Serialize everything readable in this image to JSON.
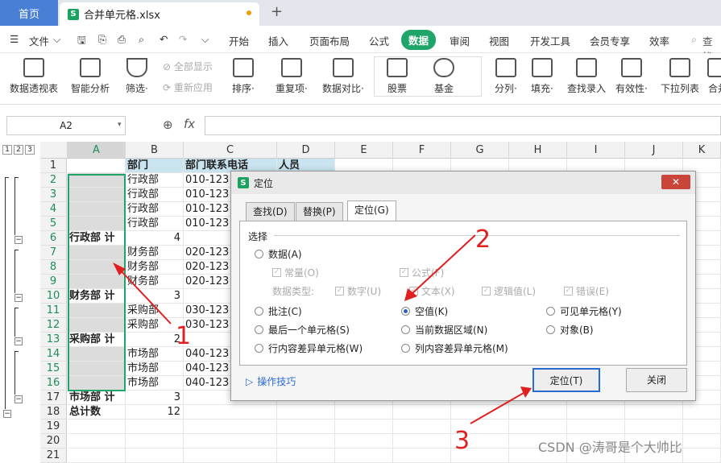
{
  "tabs": {
    "home": "首页",
    "file": "合并单元格.xlsx",
    "plus": "+"
  },
  "menu": {
    "file": "文件",
    "items": [
      "开始",
      "插入",
      "页面布局",
      "公式",
      "数据",
      "审阅",
      "视图",
      "开发工具",
      "会员专享",
      "效率"
    ],
    "active": "数据",
    "search": "查找"
  },
  "toolbar": {
    "items": [
      "数据透视表",
      "智能分析",
      "筛选·",
      "排序·",
      "重复项·",
      "数据对比·",
      "股票",
      "基金",
      "分列·",
      "填充·",
      "查找录入",
      "有效性·",
      "下拉列表",
      "合并"
    ],
    "show_all": "全部显示",
    "reapply": "重新应用"
  },
  "formula": {
    "name_box": "A2",
    "fx": "fx",
    "zoom_icon": "zoom-icon"
  },
  "outline_levels": [
    "1",
    "2",
    "3"
  ],
  "columns": [
    "A",
    "B",
    "C",
    "D",
    "E",
    "F",
    "G",
    "H",
    "I",
    "J",
    "K"
  ],
  "rows": [
    "1",
    "2",
    "3",
    "4",
    "5",
    "6",
    "7",
    "8",
    "9",
    "10",
    "11",
    "12",
    "13",
    "14",
    "15",
    "16",
    "17",
    "18",
    "19",
    "20",
    "21"
  ],
  "cells": {
    "B1": "部门",
    "C1": "部门联系电话",
    "D1": "人员",
    "B2": "行政部",
    "C2": "010-123",
    "B3": "行政部",
    "C3": "010-123",
    "B4": "行政部",
    "C4": "010-123",
    "B5": "行政部",
    "C5": "010-123",
    "A6": "行政部 计",
    "B6": "4",
    "B7": "财务部",
    "C7": "020-123",
    "B8": "财务部",
    "C8": "020-123",
    "B9": "财务部",
    "C9": "020-123",
    "A10": "财务部 计",
    "B10": "3",
    "B11": "采购部",
    "C11": "030-123",
    "B12": "采购部",
    "C12": "030-123",
    "A13": "采购部 计",
    "B13": "2",
    "B14": "市场部",
    "C14": "040-123",
    "B15": "市场部",
    "C15": "040-123",
    "B16": "市场部",
    "C16": "040-123",
    "A17": "市场部 计",
    "B17": "3",
    "A18": "总计数",
    "B18": "12"
  },
  "dialog": {
    "title": "定位",
    "tabs": [
      "查找(D)",
      "替换(P)",
      "定位(G)"
    ],
    "section": "选择",
    "data_opt": "数据(A)",
    "sub_checks": [
      "常量(O)",
      "公式(F)"
    ],
    "type_label": "数据类型:",
    "type_checks": [
      "数字(U)",
      "文本(X)",
      "逻辑值(L)",
      "错误(E)"
    ],
    "options": [
      "批注(C)",
      "空值(K)",
      "可见单元格(Y)",
      "最后一个单元格(S)",
      "当前数据区域(N)",
      "对象(B)",
      "行内容差异单元格(W)",
      "列内容差异单元格(M)"
    ],
    "selected": "空值(K)",
    "tips": "操作技巧",
    "ok": "定位(T)",
    "close": "关闭"
  },
  "callouts": [
    "1",
    "2",
    "3"
  ],
  "watermark": "CSDN @涛哥是个大帅比",
  "colors": {
    "accent": "#1fa469",
    "brand_blue": "#4a7fd6",
    "arrow_red": "#e02020"
  }
}
